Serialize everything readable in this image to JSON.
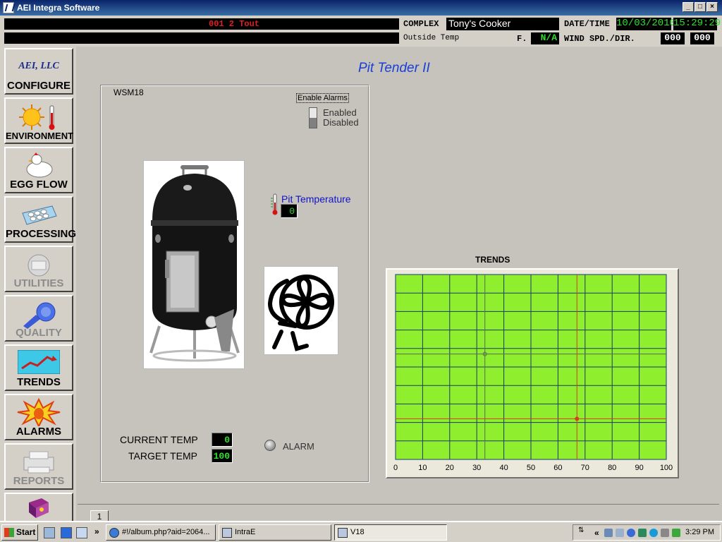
{
  "window": {
    "title": "AEI Integra Software"
  },
  "info_panel": {
    "message": "001 2 Tout",
    "complex_label": "COMPLEX",
    "complex_value": "Tony's Cooker",
    "datetime_label": "DATE/TIME",
    "date": "10/03/2010",
    "time": "15:29:29",
    "outside_temp_label": "Outside Temp",
    "temp_unit": "F.",
    "outside_temp_value": "N/A",
    "wind_label": "WIND SPD./DIR.",
    "wind_speed": "000",
    "wind_dir": "000"
  },
  "sidebar": {
    "company": "AEI, LLC",
    "items": [
      {
        "label": "CONFIGURE",
        "enabled": true
      },
      {
        "label": "ENVIRONMENT",
        "enabled": true
      },
      {
        "label": "EGG FLOW",
        "enabled": true
      },
      {
        "label": "PROCESSING",
        "enabled": true
      },
      {
        "label": "UTILITIES",
        "enabled": false
      },
      {
        "label": "QUALITY",
        "enabled": false
      },
      {
        "label": "TRENDS",
        "enabled": true
      },
      {
        "label": "ALARMS",
        "enabled": true
      },
      {
        "label": "REPORTS",
        "enabled": false
      }
    ]
  },
  "main": {
    "page_title": "Pit Tender II",
    "panel_title": "WSM18",
    "enable_alarms": {
      "label": "Enable Alarms",
      "enabled_label": "Enabled",
      "disabled_label": "Disabled",
      "state": "Disabled"
    },
    "pit_temperature": {
      "label": "Pit Temperature",
      "value": "0"
    },
    "current_temp": {
      "label": "CURRENT TEMP",
      "value": "0"
    },
    "target_temp": {
      "label": "TARGET TEMP",
      "value": "100"
    },
    "alarm_label": "ALARM",
    "trends_title": "TRENDS",
    "page_tab": "1"
  },
  "chart_data": {
    "type": "line",
    "title": "TRENDS",
    "xlim": [
      0,
      100
    ],
    "x_ticks": [
      0,
      10,
      20,
      30,
      40,
      50,
      60,
      70,
      80,
      90,
      100
    ],
    "grid": true,
    "background": "#8fef2f",
    "series": [
      {
        "values": []
      }
    ],
    "cursors": [
      {
        "x": 33,
        "y_fraction": 0.57,
        "color": "#5a6a5a"
      },
      {
        "x": 67,
        "y_fraction": 0.22,
        "color": "#d04020"
      }
    ]
  },
  "taskbar": {
    "start_label": "Start",
    "chevron": "»",
    "tasks": [
      {
        "label": "#!/album.php?aid=2064...",
        "active": false
      },
      {
        "label": "IntraE",
        "active": false
      },
      {
        "label": "V18",
        "active": true
      }
    ],
    "tray_chevron": "«",
    "clock": "3:29 PM"
  },
  "colors": {
    "title_bar": "#0a246a",
    "page_title": "#1a3fd6",
    "value_green": "#2ee02e",
    "message_red": "#e02020",
    "chart_bg": "#8fef2f",
    "chart_grid": "#1a3a6a"
  }
}
